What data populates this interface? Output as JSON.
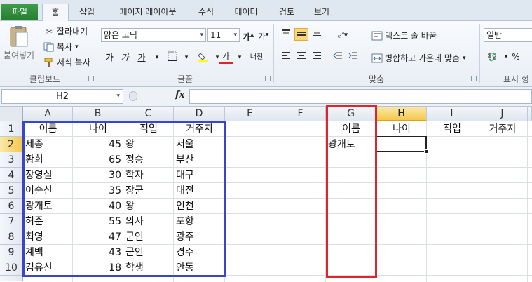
{
  "ribbon_tabs": {
    "file": "파일",
    "items": [
      "홈",
      "삽입",
      "페이지 레이아웃",
      "수식",
      "데이터",
      "검토",
      "보기"
    ]
  },
  "clipboard": {
    "paste": "붙여넣기",
    "cut": "잘라내기",
    "copy": "복사",
    "format_painter": "서식 복사",
    "label": "클립보드"
  },
  "font": {
    "name": "맑은 고딕",
    "size": "11",
    "grow": "가",
    "shrink": "가",
    "bold": "가",
    "italic": "가",
    "underline": "가",
    "font_color": "가",
    "phonetic": "내천",
    "label": "글꼴"
  },
  "alignment": {
    "wrap_text": "텍스트 줄 바꿈",
    "merge_center": "병합하고 가운데 맞춤",
    "label": "맞춤"
  },
  "number": {
    "format": "일반",
    "percent": "%",
    "label": "표시 형"
  },
  "formula_bar": {
    "name_box": "H2",
    "fx": "fx",
    "formula": ""
  },
  "sheet": {
    "columns": [
      "A",
      "B",
      "C",
      "D",
      "E",
      "F",
      "G",
      "H",
      "I",
      "J"
    ],
    "rows": [
      "1",
      "2",
      "3",
      "4",
      "5",
      "6",
      "7",
      "8",
      "9",
      "10"
    ],
    "active_cell": "H2",
    "header": [
      "이름",
      "나이",
      "직업",
      "거주지"
    ],
    "data": [
      [
        "세종",
        "45",
        "왕",
        "서울"
      ],
      [
        "황희",
        "65",
        "정승",
        "부산"
      ],
      [
        "장영실",
        "30",
        "학자",
        "대구"
      ],
      [
        "이순신",
        "35",
        "장군",
        "대전"
      ],
      [
        "광개토",
        "40",
        "왕",
        "인천"
      ],
      [
        "허준",
        "55",
        "의사",
        "포항"
      ],
      [
        "최영",
        "47",
        "군인",
        "광주"
      ],
      [
        "계백",
        "43",
        "군인",
        "경주"
      ],
      [
        "김유신",
        "18",
        "학생",
        "안동"
      ]
    ],
    "lookup_header": [
      "이름",
      "나이",
      "직업",
      "거주지"
    ],
    "lookup_name": "광개토"
  },
  "colors": {
    "file_tab": "#2e8b3a",
    "source_outline": "#3a46c8",
    "lookup_outline": "#e2232a",
    "active_header": "#f4c84e"
  }
}
